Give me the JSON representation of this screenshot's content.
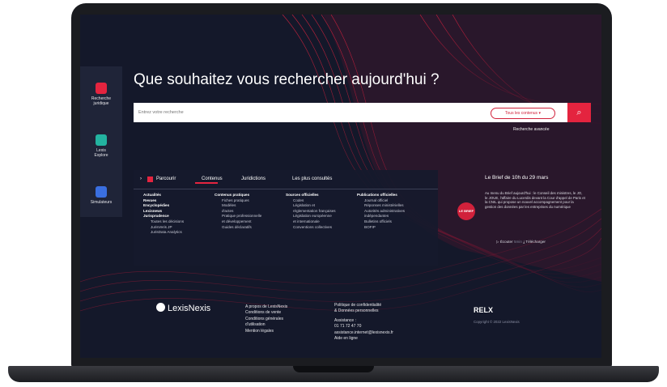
{
  "sidebar": {
    "items": [
      {
        "label_1": "Recherche",
        "label_2": "juridique",
        "icon": "search-doc-icon",
        "color": "#e4243f"
      },
      {
        "label_1": "Lexis",
        "label_2": "Explore",
        "icon": "explore-icon",
        "color": "#23b3a0"
      },
      {
        "label_1": "Simulateurs",
        "label_2": "",
        "icon": "calculator-icon",
        "color": "#3a6fe0"
      }
    ]
  },
  "main": {
    "title": "Que souhaitez vous rechercher aujourd'hui ?",
    "search": {
      "placeholder": "Entrez votre recherche",
      "scope_label": "Tous les contenus",
      "advanced_label": "Recherche avancée"
    }
  },
  "browse": {
    "parcourir": "Parcourir",
    "tabs": [
      "Contenus",
      "Juridictions",
      "Les plus consultés"
    ],
    "columns": [
      {
        "lines": [
          {
            "t": "Actualités",
            "k": "h"
          },
          {
            "t": "Revues",
            "k": "h"
          },
          {
            "t": "Encyclopédies",
            "k": "h"
          },
          {
            "t": "Lexisnews",
            "k": "h"
          },
          {
            "t": "Jurisprudence",
            "k": "h"
          },
          {
            "t": "Toutes les décisions",
            "k": "sub"
          },
          {
            "t": "JurisVeris JP",
            "k": "sub"
          },
          {
            "t": "JurisData Analytics",
            "k": "sub"
          }
        ]
      },
      {
        "lines": [
          {
            "t": "Contenus pratiques",
            "k": "h"
          },
          {
            "t": "Fiches pratiques",
            "k": "sub"
          },
          {
            "t": "Modèles",
            "k": "sub"
          },
          {
            "t": "d'actes",
            "k": "sub"
          },
          {
            "t": "Pratique professionnelle",
            "k": "sub"
          },
          {
            "t": "et développement",
            "k": "sub"
          },
          {
            "t": "Guides déclaratifs",
            "k": "sub"
          }
        ]
      },
      {
        "lines": [
          {
            "t": "Sources officielles",
            "k": "h"
          },
          {
            "t": "Codes",
            "k": "sub"
          },
          {
            "t": "Législation et",
            "k": "sub"
          },
          {
            "t": "réglementation françaises",
            "k": "sub"
          },
          {
            "t": "Législation européenne",
            "k": "sub"
          },
          {
            "t": "et internationale",
            "k": "sub"
          },
          {
            "t": "Conventions collectives",
            "k": "sub"
          }
        ]
      },
      {
        "lines": [
          {
            "t": "Publications officielles",
            "k": "h"
          },
          {
            "t": "Journal officiel",
            "k": "sub"
          },
          {
            "t": "Réponses ministérielles",
            "k": "sub"
          },
          {
            "t": "Autorités administratives",
            "k": "sub"
          },
          {
            "t": "indépendantes",
            "k": "sub"
          },
          {
            "t": "Bulletins officiels",
            "k": "sub"
          },
          {
            "t": "BOFIP",
            "k": "sub"
          }
        ]
      }
    ]
  },
  "brief": {
    "title": "Le Brief de 10h du 29 mars",
    "logo_text": "LE BRIEF",
    "text": "Au menu du Brief aujourd'hui : le Conseil des ministres, le JO, le JOUE, l'affaire du Lucerdis devant la Cour d'appel de Paris et la CNIL qui propose un nouvel accompagnement pour la gestion des données par les entreprises du numérique",
    "listen_label": "Écouter",
    "listen_time": "5min",
    "download_label": "Télécharger"
  },
  "footer": {
    "brand": "LexisNexis",
    "links_col1": [
      "A propos de LexisNexis",
      "Conditions de vente",
      "Conditions générales",
      "d'utilisation",
      "Mention légales"
    ],
    "links_col2": [
      "Politique de confidentialité",
      "& Données personnelles",
      "",
      "Assistance :",
      "01 71 72 47 70",
      "assistance.internet@lexisnexis.fr",
      "Aide en ligne"
    ],
    "relx": "RELX",
    "copyright": "Copyright © 2022 LexisNexis"
  },
  "colors": {
    "accent": "#e4243f",
    "background": "#14182a",
    "panel": "#1f2438"
  }
}
